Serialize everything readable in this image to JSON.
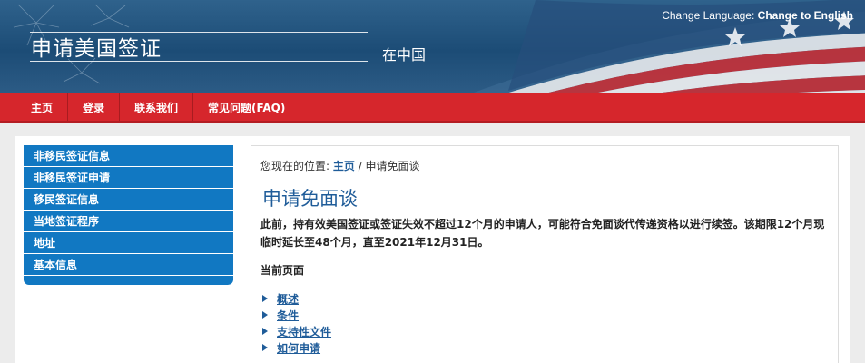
{
  "header": {
    "title": "申请美国签证",
    "country": "在中国",
    "language_prefix": "Change Language: ",
    "language_link": "Change to English"
  },
  "nav": {
    "items": [
      {
        "label": "主页"
      },
      {
        "label": "登录"
      },
      {
        "label": "联系我们"
      },
      {
        "label": "常见问题(FAQ)"
      }
    ]
  },
  "sidebar": {
    "items": [
      {
        "label": "非移民签证信息"
      },
      {
        "label": "非移民签证申请"
      },
      {
        "label": "移民签证信息"
      },
      {
        "label": "当地签证程序"
      },
      {
        "label": "地址"
      },
      {
        "label": "基本信息"
      }
    ]
  },
  "main": {
    "breadcrumb_prefix": "您现在的位置: ",
    "breadcrumb_home": "主页",
    "breadcrumb_sep": " / ",
    "breadcrumb_current": "申请免面谈",
    "title": "申请免面谈",
    "notice": "此前，持有效美国签证或签证失效不超过12个月的申请人，可能符合免面谈代传递资格以进行续签。该期限12个月现临时延长至48个月，直至2021年12月31日。",
    "section_label": "当前页面",
    "links": [
      {
        "label": "概述"
      },
      {
        "label": "条件"
      },
      {
        "label": "支持性文件"
      },
      {
        "label": "如何申请"
      }
    ]
  },
  "colors": {
    "banner_blue": "#1c4c76",
    "nav_red": "#d6262c",
    "sidebar_blue": "#1178c2",
    "link_blue": "#1f5c99"
  }
}
